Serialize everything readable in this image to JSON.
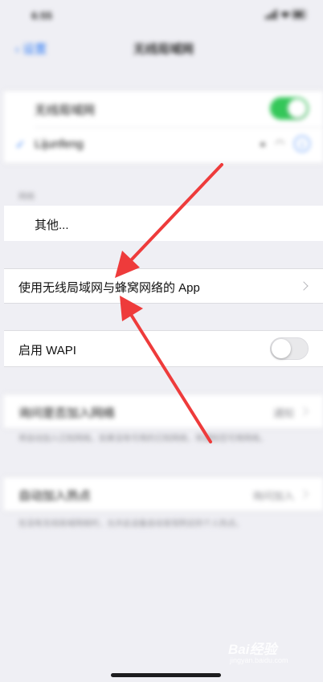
{
  "status_bar": {
    "time": "6:55"
  },
  "nav": {
    "back_label": "设置",
    "title": "无线局域网"
  },
  "wlan_group": {
    "toggle_label": "无线局域网",
    "toggle_on": true,
    "connected_network": "Lijunfeng"
  },
  "networks_header": "网络",
  "other_label": "其他...",
  "apps_label": "使用无线局域网与蜂窝网络的 App",
  "wapi": {
    "label": "启用 WAPI",
    "on": false
  },
  "ask_join": {
    "label": "询问是否加入网络",
    "value": "通知",
    "footer": "将自动加入已知网络。如果没有可用的已知网络，将通知您可用网络。"
  },
  "auto_hotspot": {
    "label": "自动加入热点",
    "value": "询问加入",
    "footer": "在没有无线局域网络时，允许此设备自动发现附近的个人热点。"
  },
  "watermark": {
    "brand": "Bai经验",
    "sub": "jingyan.baidu.com"
  },
  "colors": {
    "accent": "#2f7bf5",
    "toggle_on": "#34c759",
    "arrow": "#ee3b3b"
  }
}
